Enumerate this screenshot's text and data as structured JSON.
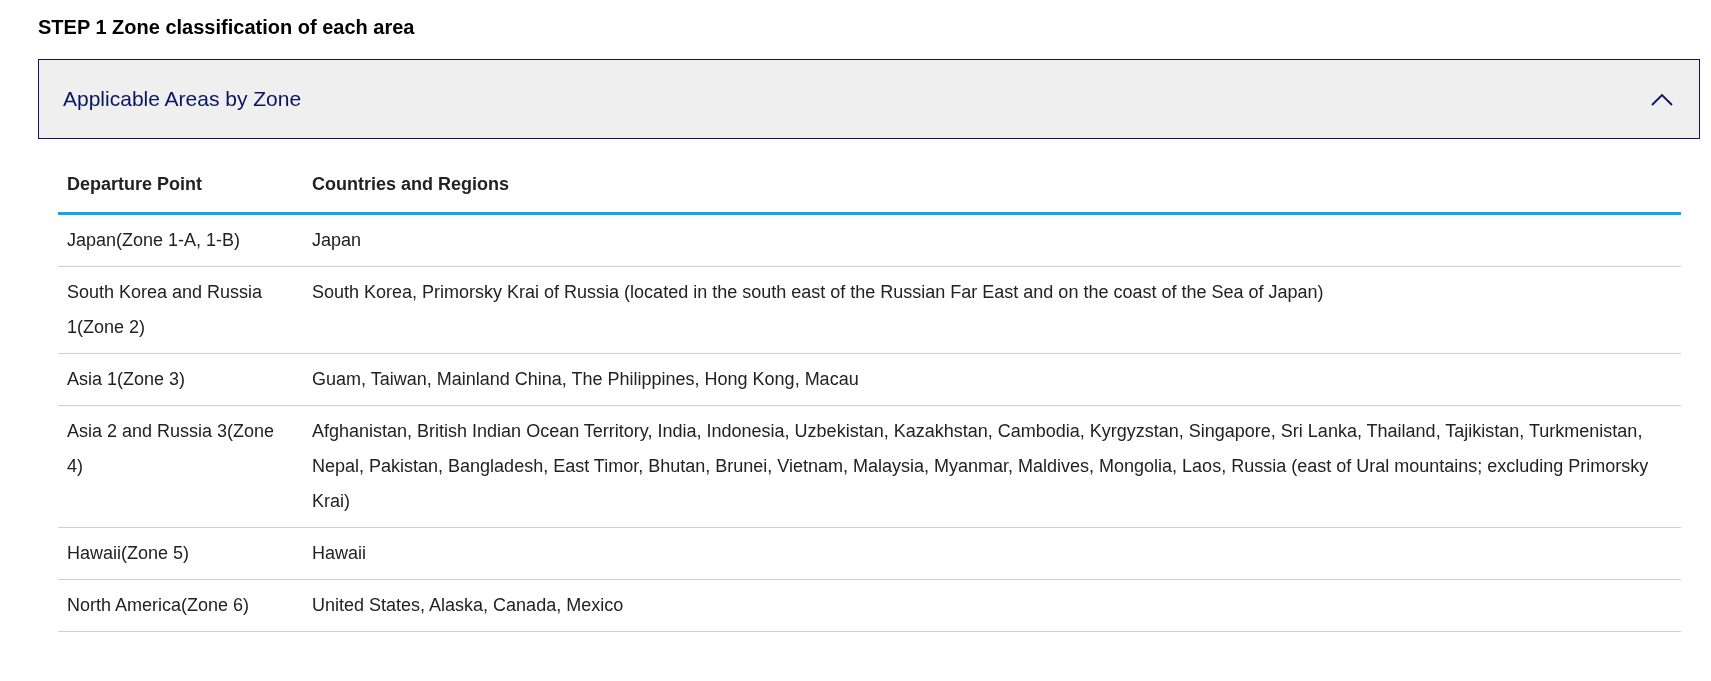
{
  "heading": "STEP 1 Zone classification of each area",
  "accordion": {
    "title": "Applicable Areas by Zone",
    "expanded": true
  },
  "table": {
    "columns": [
      "Departure Point",
      "Countries and Regions"
    ],
    "rows": [
      {
        "cells": [
          "Japan(Zone 1-A, 1-B)",
          "Japan"
        ]
      },
      {
        "cells": [
          "South Korea and Russia 1(Zone 2)",
          "South Korea, Primorsky Krai of Russia (located in the south east of the Russian Far East and on the coast of the Sea of Japan)"
        ]
      },
      {
        "cells": [
          "Asia 1(Zone 3)",
          "Guam, Taiwan, Mainland China, The Philippines, Hong Kong, Macau"
        ]
      },
      {
        "cells": [
          "Asia 2 and Russia 3(Zone 4)",
          "Afghanistan, British Indian Ocean Territory, India, Indonesia, Uzbekistan, Kazakhstan, Cambodia, Kyrgyzstan, Singapore, Sri Lanka, Thailand, Tajikistan, Turkmenistan, Nepal, Pakistan, Bangladesh, East Timor, Bhutan, Brunei, Vietnam, Malaysia, Myanmar, Maldives, Mongolia, Laos, Russia (east of Ural mountains; excluding Primorsky Krai)"
        ]
      },
      {
        "cells": [
          "Hawaii(Zone 5)",
          "Hawaii"
        ]
      },
      {
        "cells": [
          "North America(Zone 6)",
          "United States, Alaska, Canada, Mexico"
        ]
      }
    ]
  }
}
